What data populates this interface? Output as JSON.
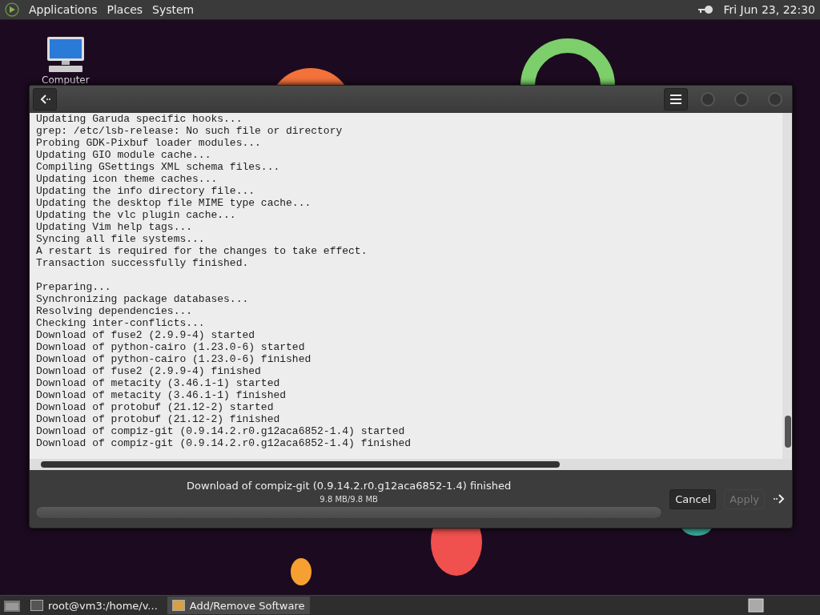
{
  "top_panel": {
    "menus": [
      {
        "label": "Applications"
      },
      {
        "label": "Places"
      },
      {
        "label": "System"
      }
    ],
    "clock": "Fri Jun 23, 22:30"
  },
  "desktop": {
    "icons": [
      {
        "label": "Computer"
      }
    ]
  },
  "window": {
    "log_blocks": [
      [
        "Updating Garuda specific hooks...",
        "grep: /etc/lsb-release: No such file or directory",
        "Probing GDK-Pixbuf loader modules...",
        "Updating GIO module cache...",
        "Compiling GSettings XML schema files...",
        "Updating icon theme caches...",
        "Updating the info directory file...",
        "Updating the desktop file MIME type cache...",
        "Updating the vlc plugin cache...",
        "Updating Vim help tags...",
        "Syncing all file systems...",
        "A restart is required for the changes to take effect.",
        "Transaction successfully finished."
      ],
      [
        "Preparing...",
        "Synchronizing package databases...",
        "Resolving dependencies...",
        "Checking inter-conflicts...",
        "Download of fuse2 (2.9.9-4) started",
        "Download of python-cairo (1.23.0-6) started",
        "Download of python-cairo (1.23.0-6) finished",
        "Download of fuse2 (2.9.9-4) finished",
        "Download of metacity (3.46.1-1) started",
        "Download of metacity (3.46.1-1) finished",
        "Download of protobuf (21.12-2) started",
        "Download of protobuf (21.12-2) finished",
        "Download of compiz-git (0.9.14.2.r0.g12aca6852-1.4) started",
        "Download of compiz-git (0.9.14.2.r0.g12aca6852-1.4) finished"
      ]
    ],
    "status": "Download of compiz-git (0.9.14.2.r0.g12aca6852-1.4) finished",
    "size": "9.8 MB/9.8 MB",
    "progress": {
      "level": 1
    },
    "buttons": [
      {
        "label": "Cancel",
        "disabled": false
      },
      {
        "label": "Apply",
        "disabled": true
      }
    ]
  },
  "taskbar": {
    "tasks": [
      {
        "label": "root@vm3:/home/v...",
        "selected": false
      },
      {
        "label": "Add/Remove Software",
        "selected": true
      }
    ]
  }
}
